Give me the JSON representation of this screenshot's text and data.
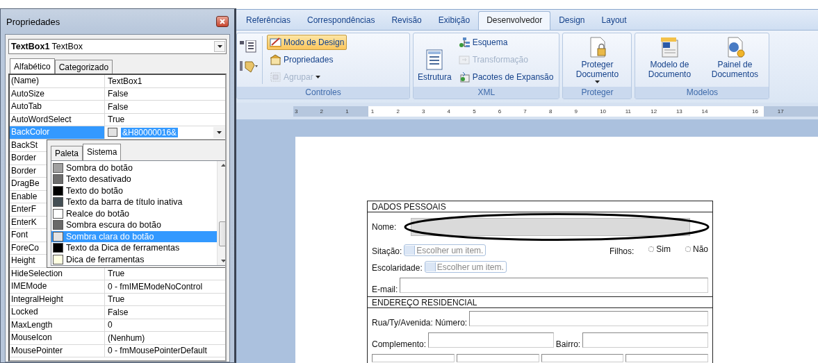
{
  "properties_window": {
    "title": "Propriedades",
    "object_selector": "**TextBox1** TextBox",
    "tabs": [
      {
        "label": "Alfabético",
        "selected": true
      },
      {
        "label": "Categorizado",
        "selected": false
      }
    ],
    "rows": [
      {
        "name": "(Name)",
        "value": "TextBox1",
        "selected": false
      },
      {
        "name": "AutoSize",
        "value": "False",
        "selected": false
      },
      {
        "name": "AutoTab",
        "value": "False",
        "selected": false
      },
      {
        "name": "AutoWordSelect",
        "value": "True",
        "selected": false
      },
      {
        "name": "BackColor",
        "value": "&H80000016&",
        "color": "#e2e2e2",
        "selected": true
      },
      {
        "name": "BackSt",
        "selected": false
      },
      {
        "name": "Border",
        "selected": false
      },
      {
        "name": "Border",
        "selected": false
      },
      {
        "name": "DragBe",
        "selected": false
      },
      {
        "name": "Enable",
        "selected": false
      },
      {
        "name": "EnterF",
        "selected": false
      },
      {
        "name": "EnterK",
        "selected": false
      },
      {
        "name": "Font",
        "selected": false
      },
      {
        "name": "ForeCo",
        "selected": false
      },
      {
        "name": "Height",
        "selected": false
      },
      {
        "name": "HideSelection",
        "value": "True",
        "selected": false
      },
      {
        "name": "IMEMode",
        "value": "0 - fmIMEModeNoControl",
        "selected": false
      },
      {
        "name": "IntegralHeight",
        "value": "True",
        "selected": false
      },
      {
        "name": "Locked",
        "value": "False",
        "selected": false
      },
      {
        "name": "MaxLength",
        "value": "0",
        "selected": false
      },
      {
        "name": "MouseIcon",
        "value": "(Nenhum)",
        "selected": false
      },
      {
        "name": "MousePointer",
        "value": "0 - fmMousePointerDefault",
        "selected": false
      }
    ],
    "color_dropdown": {
      "tabs": [
        {
          "label": "Paleta",
          "selected": false
        },
        {
          "label": "Sistema",
          "selected": true
        }
      ],
      "items": [
        {
          "label": "Sombra do botão",
          "color": "#a0a0a0",
          "selected": false
        },
        {
          "label": "Texto desativado",
          "color": "#6d6d6d",
          "selected": false
        },
        {
          "label": "Texto do botão",
          "color": "#000000",
          "selected": false
        },
        {
          "label": "Texto da barra de título inativa",
          "color": "#434e54",
          "selected": false
        },
        {
          "label": "Realce do botão",
          "color": "#ffffff",
          "selected": false
        },
        {
          "label": "Sombra escura do botão",
          "color": "#696969",
          "selected": false
        },
        {
          "label": "Sombra clara do botão",
          "color": "#e3e3e3",
          "selected": true
        },
        {
          "label": "Texto da Dica de ferramentas",
          "color": "#000000",
          "selected": false
        },
        {
          "label": "Dica de ferramentas",
          "color": "#ffffe1",
          "selected": false
        }
      ]
    }
  },
  "word": {
    "tabs": [
      {
        "label": "Referências",
        "selected": false
      },
      {
        "label": "Correspondências",
        "selected": false
      },
      {
        "label": "Revisão",
        "selected": false
      },
      {
        "label": "Exibição",
        "selected": false
      },
      {
        "label": "Desenvolvedor",
        "selected": true
      },
      {
        "label": "Design",
        "selected": false
      },
      {
        "label": "Layout",
        "selected": false
      }
    ],
    "groups": [
      {
        "label": "Controles",
        "items": [
          {
            "kind": "icon_grid"
          },
          {
            "kind": "small",
            "label": "Modo de Design",
            "pressed": true,
            "disabled": false,
            "menu": false
          },
          {
            "kind": "small",
            "label": "Propriedades",
            "pressed": false,
            "disabled": false,
            "menu": false
          },
          {
            "kind": "small",
            "label": "Agrupar",
            "pressed": false,
            "disabled": true,
            "menu": true
          }
        ]
      },
      {
        "label": "XML",
        "items": [
          {
            "kind": "large",
            "label": "Estrutura",
            "menu": false
          },
          {
            "kind": "small",
            "label": "Esquema",
            "pressed": false,
            "disabled": false,
            "menu": false
          },
          {
            "kind": "small",
            "label": "Transformação",
            "pressed": false,
            "disabled": true,
            "menu": false
          },
          {
            "kind": "small",
            "label": "Pacotes de Expansão",
            "pressed": false,
            "disabled": false,
            "menu": false
          }
        ]
      },
      {
        "label": "Proteger",
        "items": [
          {
            "kind": "large",
            "label": "Proteger Documento",
            "menu": true
          }
        ]
      },
      {
        "label": "Modelos",
        "items": [
          {
            "kind": "large",
            "label": "Modelo de Documento",
            "menu": false
          },
          {
            "kind": "large",
            "label": "Painel de Documentos",
            "menu": false
          }
        ]
      }
    ],
    "ruler": [
      "3",
      "2",
      "1",
      "1",
      "2",
      "3",
      "4",
      "5",
      "6",
      "7",
      "8",
      "9",
      "10",
      "11",
      "12",
      "13",
      "14",
      "16",
      "17"
    ],
    "form": {
      "sections": [
        {
          "title": "DADOS PESSOAIS",
          "rows": [
            [
              {
                "kind": "label",
                "text": "Nome:"
              },
              {
                "kind": "field",
                "shaded": true
              }
            ],
            [
              {
                "kind": "label",
                "text": "Sitação:"
              },
              {
                "kind": "dropdown",
                "placeholder": "Escolher um item."
              },
              {
                "kind": "spacer"
              },
              {
                "kind": "label",
                "text": "Filhos:"
              },
              {
                "kind": "radio",
                "text": "Sim",
                "selected": false
              },
              {
                "kind": "radio",
                "text": "Não",
                "selected": false
              }
            ],
            [
              {
                "kind": "label",
                "text": "Escolaridade:"
              },
              {
                "kind": "dropdown",
                "placeholder": "Escolher um item."
              }
            ],
            [
              {
                "kind": "label",
                "text": "E-mail:"
              },
              {
                "kind": "field",
                "shaded": false
              }
            ]
          ]
        },
        {
          "title": "ENDEREÇO RESIDENCIAL",
          "rows": [
            [
              {
                "kind": "label",
                "text": "Rua/Ty/Avenida: Número:"
              },
              {
                "kind": "field",
                "shaded": false
              }
            ],
            [
              {
                "kind": "label",
                "text": "Complemento:"
              },
              {
                "kind": "field",
                "shaded": false
              },
              {
                "kind": "label",
                "text": "Bairro:"
              },
              {
                "kind": "field",
                "shaded": false
              }
            ],
            [
              {
                "kind": "field",
                "shaded": false
              },
              {
                "kind": "field",
                "shaded": false
              },
              {
                "kind": "field",
                "shaded": false
              },
              {
                "kind": "field",
                "shaded": false
              }
            ]
          ]
        }
      ]
    }
  }
}
